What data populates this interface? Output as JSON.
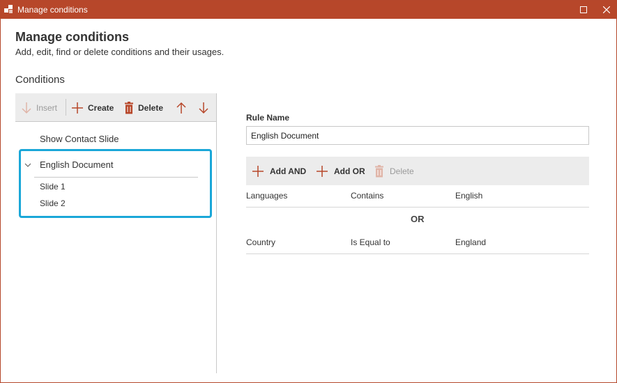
{
  "window": {
    "title": "Manage conditions",
    "accent_color": "#b7472a",
    "highlight_color": "#1aa7d8"
  },
  "header": {
    "title": "Manage conditions",
    "subtitle": "Add, edit, find or delete conditions and their usages."
  },
  "conditions": {
    "section_title": "Conditions",
    "toolbar": {
      "insert_label": "Insert",
      "create_label": "Create",
      "delete_label": "Delete"
    },
    "items": [
      {
        "label": "Show Contact Slide"
      },
      {
        "label": "English Document",
        "expanded": true,
        "children": [
          "Slide 1",
          "Slide 2"
        ]
      }
    ]
  },
  "rule": {
    "name_label": "Rule Name",
    "name_value": "English Document",
    "toolbar": {
      "add_and_label": "Add AND",
      "add_or_label": "Add OR",
      "delete_label": "Delete"
    },
    "rows": [
      {
        "field": "Languages",
        "operator": "Contains",
        "value": "English"
      },
      {
        "field": "Country",
        "operator": "Is Equal to",
        "value": "England"
      }
    ],
    "or_label": "OR"
  }
}
